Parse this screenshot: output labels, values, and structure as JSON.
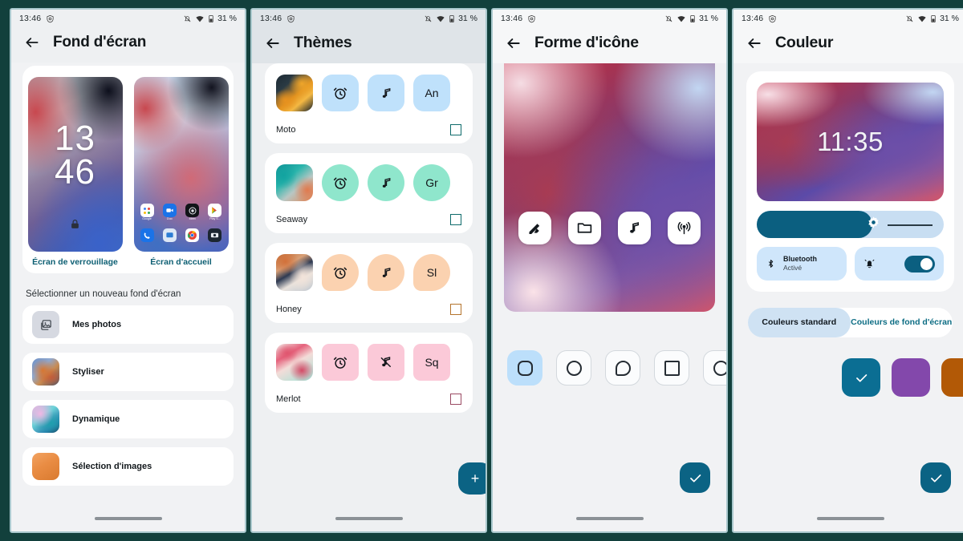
{
  "theme": {
    "page_background": "#12403c",
    "accent_teal": "#0b6384",
    "link_teal": "#0d6d84"
  },
  "status_bar": {
    "time": "13:46",
    "battery_percent": "31 %",
    "icons": [
      "alarm-shield-icon",
      "notifications-muted-icon",
      "wifi-icon",
      "battery-icon"
    ]
  },
  "panels": [
    {
      "id": "wallpaper",
      "title": "Fond d'écran",
      "preview": {
        "lock_time_hours": "13",
        "lock_time_minutes": "46",
        "lock_label": "Écran de verrouillage",
        "home_label": "Écran d'accueil",
        "home_apps_row1": [
          "Google",
          "Duo",
          "Meet",
          "Play S..."
        ],
        "home_apps_row2": [
          "Téléphone",
          "Messages",
          "Chrome",
          "Appareil photo"
        ]
      },
      "section_title": "Sélectionner un nouveau fond d'écran",
      "options": [
        {
          "label": "Mes photos",
          "icon": "my-photos-icon"
        },
        {
          "label": "Styliser",
          "icon": "stylize-icon"
        },
        {
          "label": "Dynamique",
          "icon": "dynamic-icon"
        },
        {
          "label": "Sélection d'images",
          "icon": "image-picker-icon"
        }
      ]
    },
    {
      "id": "themes",
      "title": "Thèmes",
      "fab_label": "+",
      "themes": [
        {
          "name": "Moto",
          "tile_color": "#bfe1fb",
          "shape": "sq",
          "checkbox_color": "#0e6b6b",
          "selected": false,
          "abbr": "An",
          "third_icon": "music-note-icon"
        },
        {
          "name": "Seaway",
          "tile_color": "#8fe6cc",
          "shape": "circ",
          "checkbox_color": "#0e6b6b",
          "selected": false,
          "abbr": "Gr",
          "third_icon": "music-note-icon"
        },
        {
          "name": "Honey",
          "tile_color": "#fbd2b0",
          "shape": "teardrop",
          "checkbox_color": "#b4742c",
          "selected": false,
          "abbr": "Sl",
          "third_icon": "music-note-icon"
        },
        {
          "name": "Merlot",
          "tile_color": "#fbc9d8",
          "shape": "sqr",
          "checkbox_color": "#9a4a63",
          "selected": false,
          "abbr": "Sq",
          "third_icon": "music-note-muted-icon"
        }
      ]
    },
    {
      "id": "icon-shape",
      "title": "Forme d'icône",
      "preview_icons": [
        "pencil-edit-icon",
        "folder-icon",
        "music-note-icon",
        "broadcast-icon"
      ],
      "shapes": [
        {
          "name": "squircle",
          "selected": true
        },
        {
          "name": "circle",
          "selected": false
        },
        {
          "name": "teardrop",
          "selected": false
        },
        {
          "name": "square",
          "selected": false
        },
        {
          "name": "hexagon",
          "selected": false
        }
      ],
      "confirm_label": "✓"
    },
    {
      "id": "color",
      "title": "Couleur",
      "preview_time": "11:35",
      "brightness_percent": 62,
      "quick_settings": [
        {
          "title": "Bluetooth",
          "subtitle": "Activé",
          "icon": "bluetooth-icon"
        },
        {
          "title": "",
          "subtitle": "",
          "icon": "bell-icon",
          "toggle_on": true
        }
      ],
      "tabs": [
        {
          "label": "Couleurs standard",
          "active": true
        },
        {
          "label": "Couleurs de fond d'écran",
          "active": false
        }
      ],
      "swatches": [
        {
          "color": "#0b6e93",
          "selected": true
        },
        {
          "color": "#8348ab",
          "selected": false
        },
        {
          "color": "#b25906",
          "selected": false
        }
      ],
      "confirm_label": "✓"
    }
  ]
}
